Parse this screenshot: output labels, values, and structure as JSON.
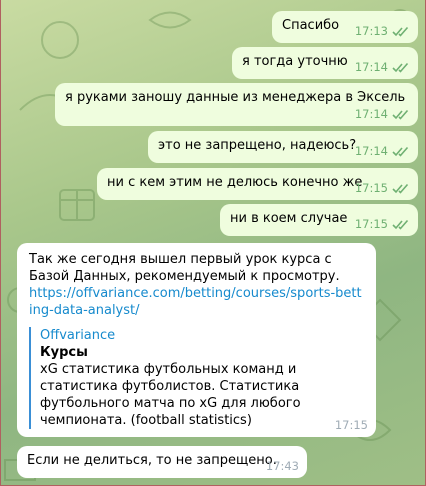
{
  "theme": {
    "outgoing_bubble": "#effdde",
    "incoming_bubble": "#ffffff",
    "link": "#168acd",
    "time_out": "#6fb072"
  },
  "messages": [
    {
      "text": "Спасибо",
      "time": "17:13",
      "read": true
    },
    {
      "text": "я тогда уточню",
      "time": "17:14",
      "read": true
    },
    {
      "text": "я руками заношу данные из менеджера в Эксель",
      "time": "17:14",
      "read": true
    },
    {
      "text": "это не запрещено, надеюсь?",
      "time": "17:14",
      "read": true
    },
    {
      "text": "ни с кем этим не делюсь конечно же",
      "time": "17:15",
      "read": true
    },
    {
      "text": "ни в коем случае",
      "time": "17:15",
      "read": true
    }
  ],
  "incoming_1": {
    "text": "Так же сегодня вышел первый урок курса с Базой Данных, рекомендуемый к просмотру.",
    "link": "https://offvariance.com/betting/courses/sports-betting-data-analyst/",
    "preview": {
      "site": "Offvariance",
      "title": "Курсы",
      "description": "xG статистика футбольных команд и статистика футболистов. Статистика футбольного матча по xG для любого чемпионата. (football statistics)"
    },
    "time": "17:15"
  },
  "incoming_2": {
    "text": "Если не делиться, то не запрещено.",
    "time": "17:43"
  }
}
